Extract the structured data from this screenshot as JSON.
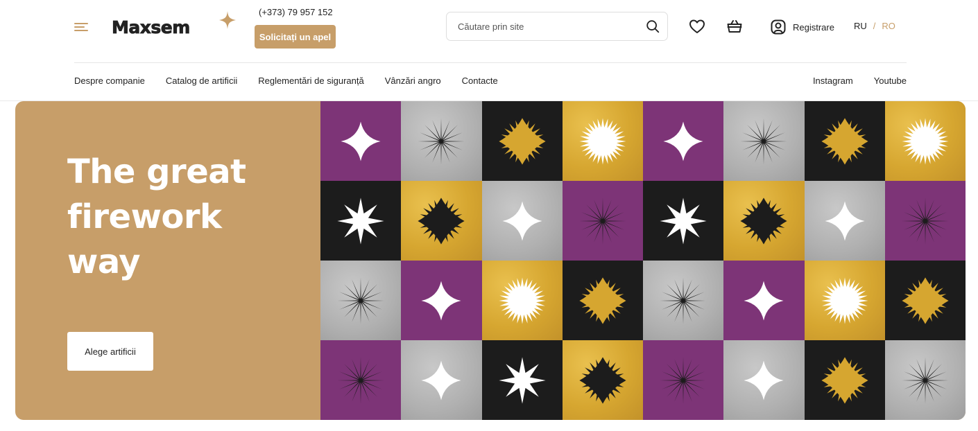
{
  "brand": {
    "name": "Maxsem",
    "accent": "#c79e69"
  },
  "contact": {
    "phone": "(+373) 79 957 152",
    "call_button": "Solicitați un apel"
  },
  "search": {
    "placeholder": "Căutare prin site"
  },
  "account": {
    "label": "Registrare"
  },
  "languages": {
    "ru": "RU",
    "separator": "/",
    "ro": "RO",
    "active": "RO"
  },
  "nav": [
    "Despre companie",
    "Catalog de artificii",
    "Reglementări de siguranță",
    "Vânzări angro",
    "Contacte"
  ],
  "social": [
    "Instagram",
    "Youtube"
  ],
  "hero": {
    "title_lines": [
      "The great",
      "firework",
      "way"
    ],
    "button": "Alege artificii"
  },
  "pattern": {
    "colors": {
      "purple": "#7d3477",
      "black": "#1c1c1c",
      "gold": "#d6a630",
      "silver": "#b3b3b3",
      "white": "#ffffff"
    },
    "rows": [
      [
        [
          "purple",
          "sparkle",
          "white"
        ],
        [
          "silver",
          "burst",
          "black"
        ],
        [
          "black",
          "spiky-diamond",
          "gold"
        ],
        [
          "gold",
          "sun",
          "white"
        ],
        [
          "purple",
          "sparkle",
          "white"
        ],
        [
          "silver",
          "burst",
          "black"
        ],
        [
          "black",
          "spiky-diamond",
          "gold"
        ],
        [
          "gold",
          "sun",
          "white"
        ]
      ],
      [
        [
          "black",
          "star8",
          "white"
        ],
        [
          "gold",
          "spiky-diamond",
          "black"
        ],
        [
          "silver",
          "sparkle",
          "white"
        ],
        [
          "purple",
          "burst",
          "black"
        ],
        [
          "black",
          "star8",
          "white"
        ],
        [
          "gold",
          "spiky-diamond",
          "black"
        ],
        [
          "silver",
          "sparkle",
          "white"
        ],
        [
          "purple",
          "burst",
          "black"
        ]
      ],
      [
        [
          "silver",
          "burst",
          "black"
        ],
        [
          "purple",
          "sparkle",
          "white"
        ],
        [
          "gold",
          "sun",
          "white"
        ],
        [
          "black",
          "spiky-diamond",
          "gold"
        ],
        [
          "silver",
          "burst",
          "black"
        ],
        [
          "purple",
          "sparkle",
          "white"
        ],
        [
          "gold",
          "sun",
          "white"
        ],
        [
          "black",
          "spiky-diamond",
          "gold"
        ]
      ],
      [
        [
          "purple",
          "burst",
          "black"
        ],
        [
          "silver",
          "sparkle",
          "white"
        ],
        [
          "black",
          "star8",
          "white"
        ],
        [
          "gold",
          "spiky-diamond",
          "black"
        ],
        [
          "purple",
          "burst",
          "black"
        ],
        [
          "silver",
          "sparkle",
          "white"
        ],
        [
          "black",
          "spiky-diamond",
          "gold"
        ],
        [
          "silver",
          "burst",
          "black"
        ]
      ]
    ]
  }
}
